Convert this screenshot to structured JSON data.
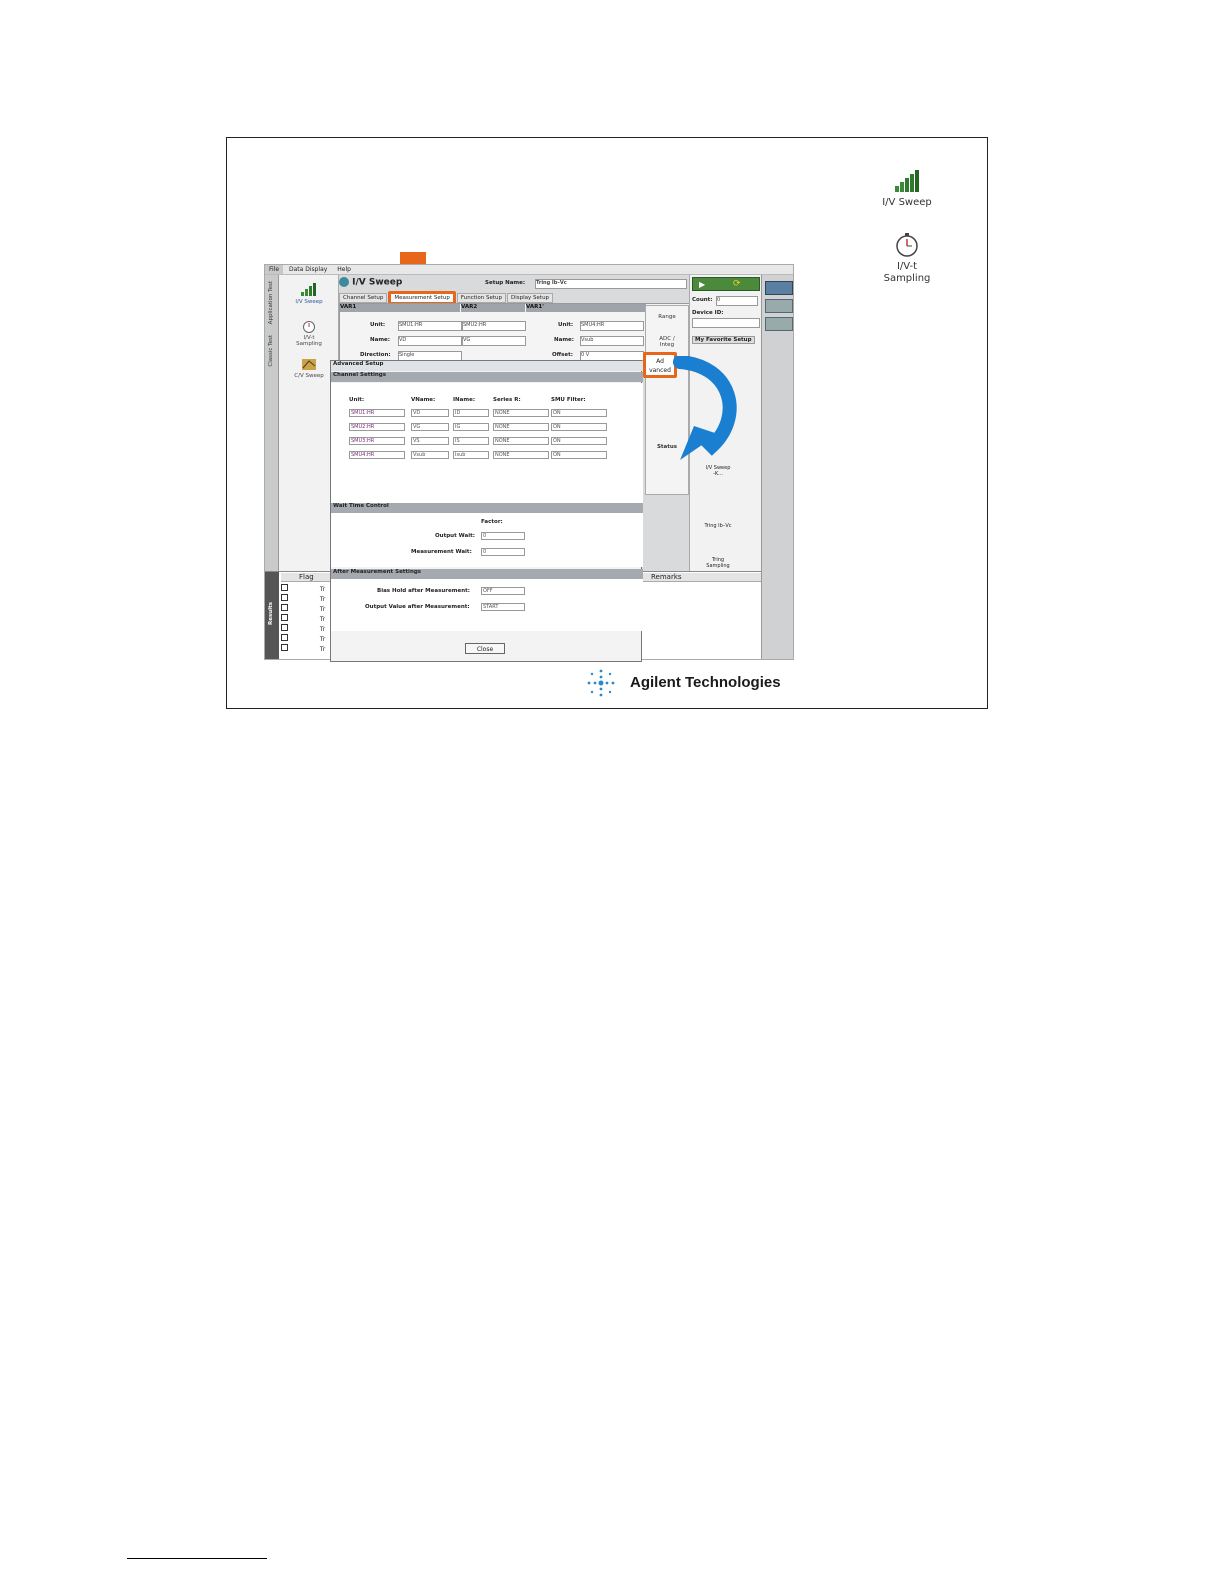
{
  "right_icons": [
    {
      "label": "I/V Sweep",
      "icon": "staircase-icon"
    },
    {
      "label": "I/V-t\nSampling",
      "icon": "stopwatch-icon"
    }
  ],
  "menu": [
    "File",
    "Data Display",
    "Help"
  ],
  "vertical_tabs": [
    "Application Test",
    "Classic Test"
  ],
  "left_panel": [
    "I/V Sweep",
    "I/V-t\nSampling",
    "C/V Sweep"
  ],
  "app": {
    "title": "I/V Sweep",
    "setup_name_label": "Setup Name:",
    "setup_name_value": "Tring Ib–Vc",
    "tabs": [
      "Channel Setup",
      "Measurement Setup",
      "Function Setup",
      "Display Setup"
    ],
    "var_headers": [
      "VAR1",
      "VAR2",
      "VAR1'"
    ],
    "var1": {
      "unit_label": "Unit:",
      "unit": "SMU1:HR",
      "name_label": "Name:",
      "name": "VD",
      "direction_label": "Direction:",
      "direction": "Single"
    },
    "var2": {
      "unit": "SMU2:HR",
      "name": "VG"
    },
    "var1p": {
      "unit_label": "Unit:",
      "unit": "SMU4:HR",
      "name_label": "Name:",
      "name": "Vsub",
      "offset_label": "Offset:",
      "offset": "0 V"
    },
    "side_buttons": [
      "Range",
      "ADC /\nInteg",
      "Ad\nvanced"
    ],
    "side_extra": [
      "Status"
    ],
    "right_panel": {
      "count_label": "Count:",
      "count_value": "0",
      "device_label": "Device ID:",
      "favorites": "My Favorite Setup",
      "items": [
        "I/V Sweep\n-K...",
        "Tring Ib–Vc",
        "Tring\nSampling"
      ]
    },
    "results": {
      "flag": "Flag",
      "remarks": "Remarks",
      "side_label": "Results",
      "rows": [
        "Tr",
        "Tr",
        "Tr",
        "Tr",
        "Tr",
        "Tr",
        "Tr"
      ]
    }
  },
  "dialog": {
    "title": "Advanced Setup",
    "channel_settings": "Channel Settings",
    "columns": [
      "Unit:",
      "VName:",
      "IName:",
      "Series R:",
      "SMU Filter:"
    ],
    "rows": [
      [
        "SMU1:HR",
        "VD",
        "ID",
        "NONE",
        "ON"
      ],
      [
        "SMU2:HR",
        "VG",
        "IG",
        "NONE",
        "ON"
      ],
      [
        "SMU3:HR",
        "VS",
        "IS",
        "NONE",
        "ON"
      ],
      [
        "SMU4:HR",
        "Vsub",
        "Isub",
        "NONE",
        "ON"
      ]
    ],
    "wait_time": "Wait Time Control",
    "factor_label": "Factor:",
    "output_wait_label": "Output Wait:",
    "output_wait": "0",
    "meas_wait_label": "Measurement Wait:",
    "meas_wait": "0",
    "after_meas": "After Measurement Settings",
    "bias_hold_label": "Bias Hold after Measurement:",
    "bias_hold": "OFF",
    "output_after_label": "Output Value after Measurement:",
    "output_after": "START",
    "close": "Close"
  },
  "logo": "Agilent Technologies",
  "colors": {
    "highlight": "#e8661c",
    "arrow": "#1a7fd0"
  }
}
